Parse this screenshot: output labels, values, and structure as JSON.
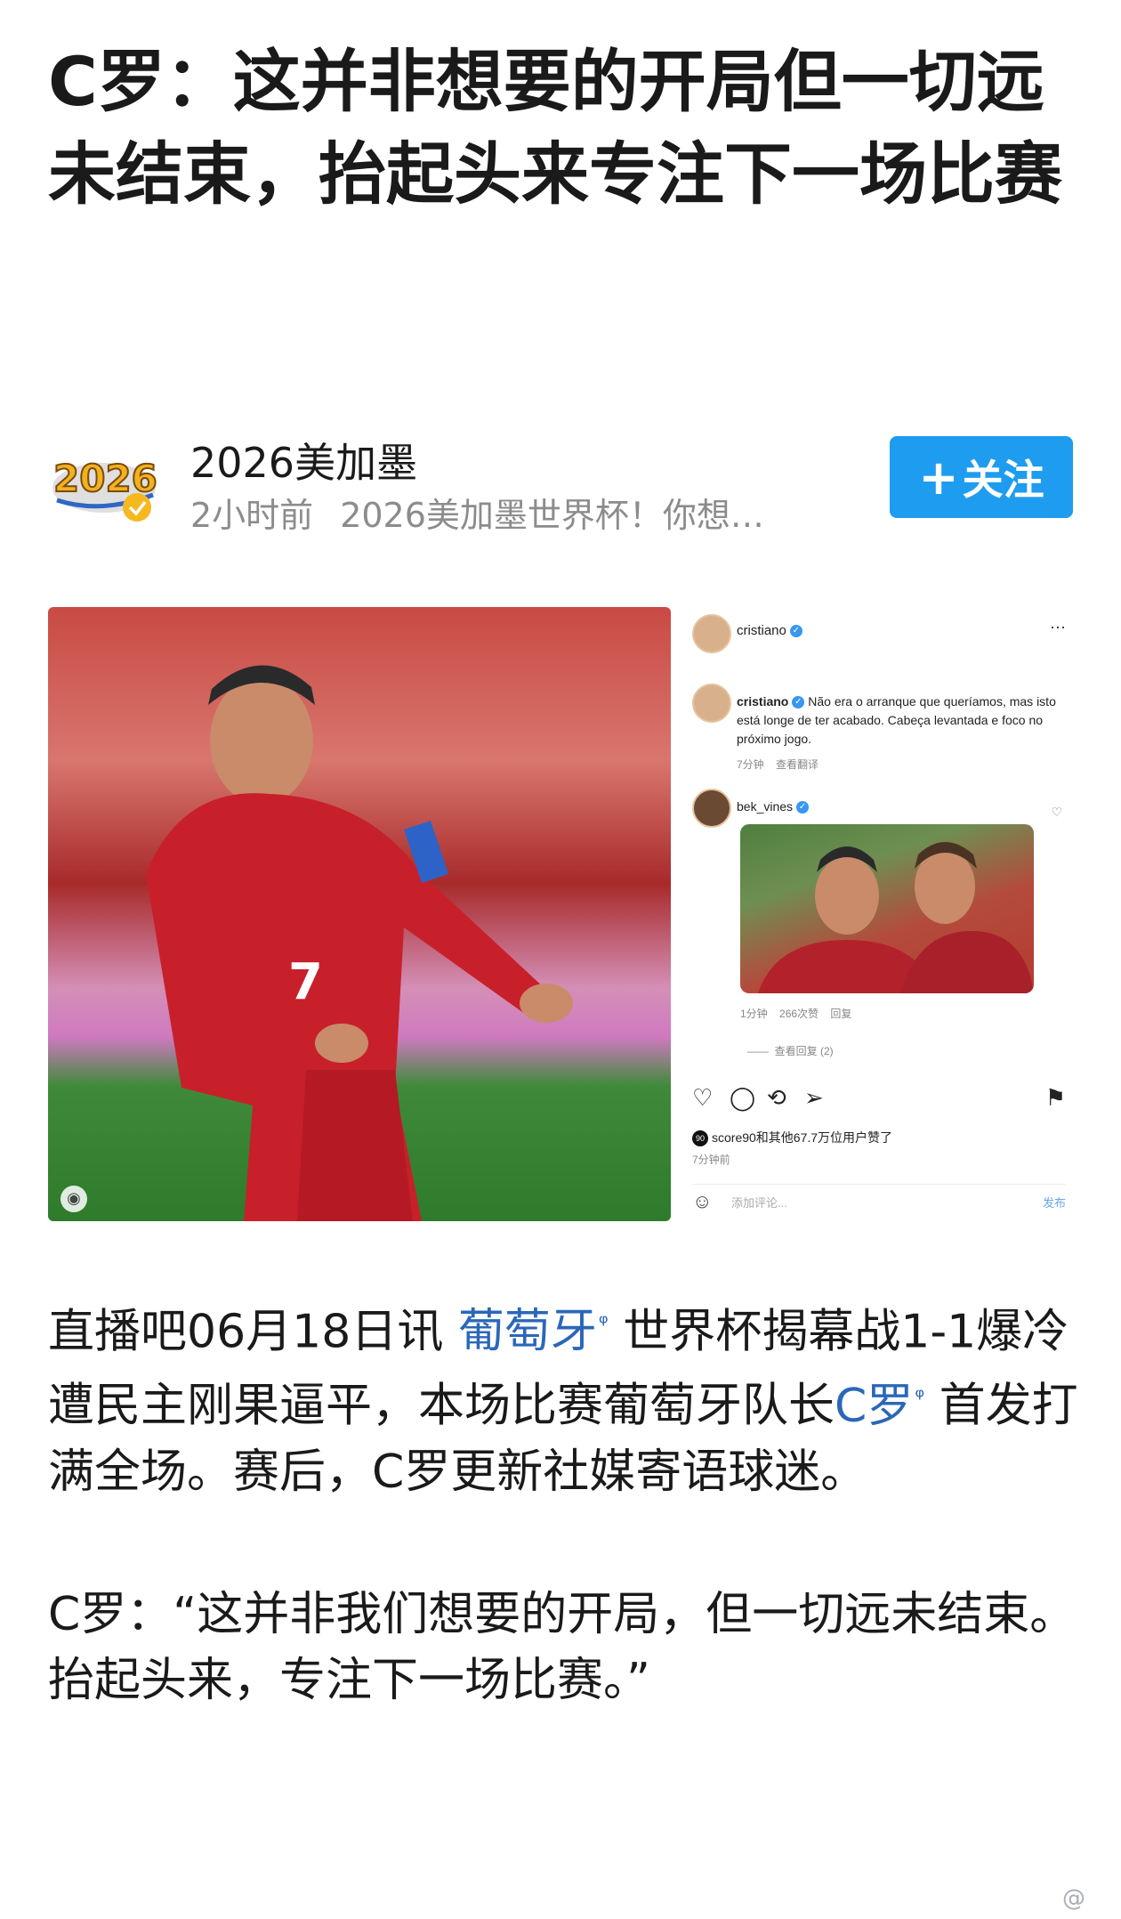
{
  "article": {
    "title": "C罗：这并非想要的开局但一切远未结束，抬起头来专注下一场比赛",
    "author": {
      "name": "2026美加墨",
      "avatar_text": "2026",
      "time": "2小时前",
      "description": "2026美加墨世界杯！你想…",
      "follow_label": "关注"
    },
    "body": {
      "p1_pre": "直播吧06月18日讯 ",
      "p1_link1": "葡萄牙",
      "p1_mid": " 世界杯揭幕战1-1爆冷遭民主刚果逼平，本场比赛葡萄牙队长",
      "p1_link2": "C罗",
      "p1_post": " 首发打满全场。赛后，C罗更新社媒寄语球迷。",
      "p2": "C罗：“这并非我们想要的开局，但一切远未结束。抬起头来，专注下一场比赛。”"
    },
    "watermark": "@"
  },
  "instagram": {
    "header_user": "cristiano",
    "caption_user": "cristiano",
    "caption_text": "Não era o arranque que queríamos, mas isto está longe de ter acabado. Cabeça levantada e foco no próximo jogo.",
    "caption_time": "7分钟",
    "caption_translate": "查看翻译",
    "reply_user": "bek_vines",
    "reply_time": "1分钟",
    "reply_likes": "266次赞",
    "reply_action": "回复",
    "view_replies": "查看回复 (2)",
    "likes_avatar": "90",
    "likes_text": "score90和其他67.7万位用户赞了",
    "likes_time": "7分钟前",
    "comment_placeholder": "添加评论...",
    "post_label": "发布"
  },
  "photo": {
    "jersey_number": "7"
  }
}
